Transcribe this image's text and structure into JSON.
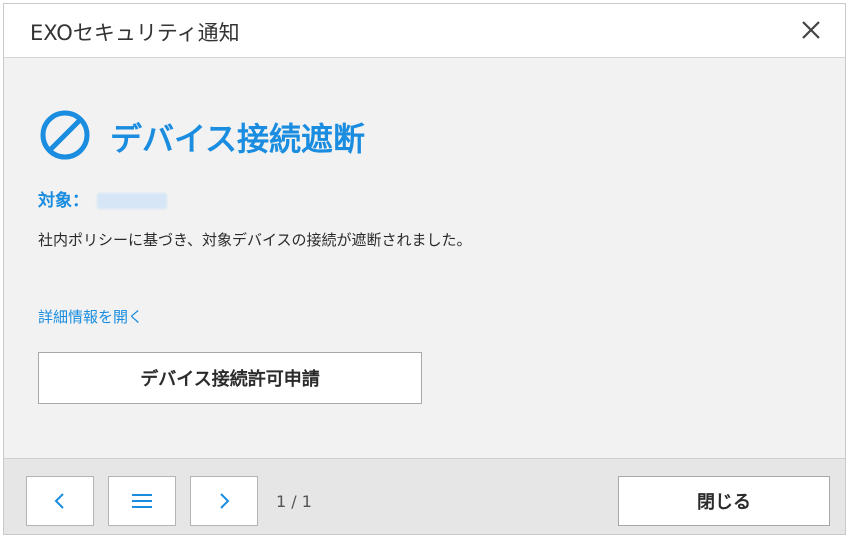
{
  "window": {
    "title": "EXOセキュリティ通知",
    "close_icon": "close-icon"
  },
  "notice": {
    "icon": "block-icon",
    "heading": "デバイス接続遮断",
    "target_label": "対象：",
    "message": "社内ポリシーに基づき、対象デバイスの接続が遮断されました。",
    "detail_link": "詳細情報を開く",
    "request_button": "デバイス接続許可申請"
  },
  "footer": {
    "prev_icon": "chevron-left-icon",
    "list_icon": "list-icon",
    "next_icon": "chevron-right-icon",
    "page_indicator": "1 / 1",
    "close_button": "閉じる"
  },
  "colors": {
    "accent": "#1a8de0",
    "content_bg": "#f2f2f2",
    "footer_bg": "#e6e6e6"
  }
}
